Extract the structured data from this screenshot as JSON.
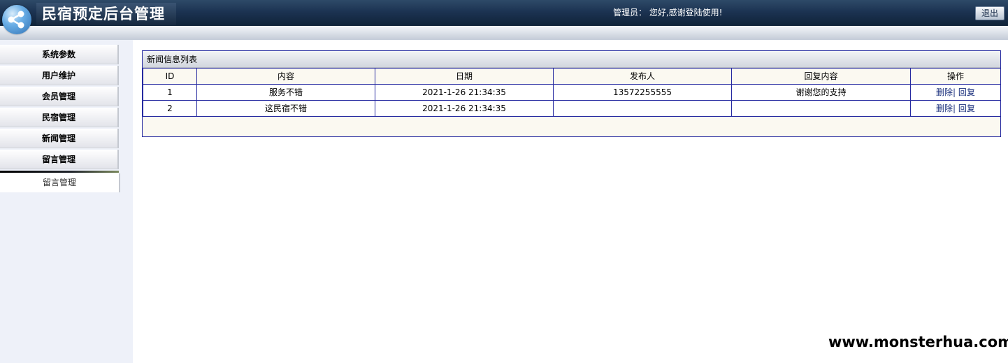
{
  "header": {
    "title": "民宿预定后台管理",
    "greeting": "管理员：  您好,感谢登陆使用!",
    "logout_label": "退出"
  },
  "sidebar": {
    "items": [
      {
        "label": "系统参数"
      },
      {
        "label": "用户维护"
      },
      {
        "label": "会员管理"
      },
      {
        "label": "民宿管理"
      },
      {
        "label": "新闻管理"
      },
      {
        "label": "留言管理"
      }
    ],
    "submenu": [
      {
        "label": "留言管理"
      }
    ]
  },
  "panel": {
    "title": "新闻信息列表",
    "columns": [
      "ID",
      "内容",
      "日期",
      "发布人",
      "回复内容",
      "操作"
    ],
    "rows": [
      {
        "id": "1",
        "content": "服务不错",
        "date": "2021-1-26 21:34:35",
        "publisher": "13572255555",
        "reply": "谢谢您的支持",
        "delete": "删除|",
        "reply_op": "回复"
      },
      {
        "id": "2",
        "content": "这民宿不错",
        "date": "2021-1-26 21:34:35",
        "publisher": "",
        "reply": "",
        "delete": "删除|",
        "reply_op": "回复"
      }
    ]
  },
  "watermark": "www.monsterhua.com",
  "colors": {
    "header_bg": "#1c3352",
    "table_border": "#262aa0",
    "panel_bg": "#fbf9f1",
    "sidebar_bg": "#eef1f9"
  }
}
